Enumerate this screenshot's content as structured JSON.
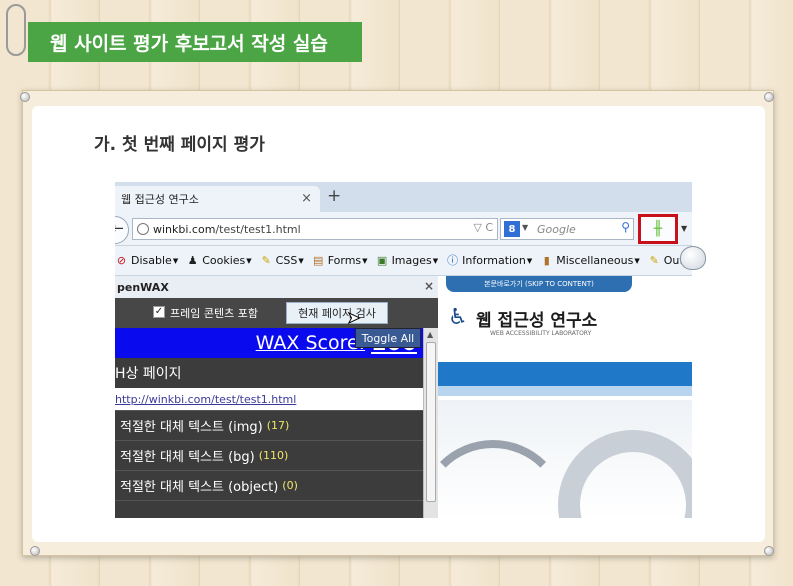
{
  "slide": {
    "header_title": "웹 사이트 평가 후보고서 작성 실습",
    "section_title": "가. 첫 번째 페이지 평가"
  },
  "browser": {
    "tab_title": "웹 접근성 연구소",
    "tab_close": "×",
    "new_tab": "+",
    "url_host": "winkbi.com",
    "url_path": "/test/test1.html",
    "url_icons": "▽ C",
    "search_placeholder": "Google",
    "search_engine_letter": "8",
    "toolbar": [
      {
        "label": "Disable",
        "icon": "⊘",
        "color": "#c8101a"
      },
      {
        "label": "Cookies",
        "icon": "♟",
        "color": "#222"
      },
      {
        "label": "CSS",
        "icon": "✎",
        "color": "#c9a300"
      },
      {
        "label": "Forms",
        "icon": "▤",
        "color": "#b0722a"
      },
      {
        "label": "Images",
        "icon": "▣",
        "color": "#3c7a2c"
      },
      {
        "label": "Information",
        "icon": "ⓘ",
        "color": "#1f5fbf"
      },
      {
        "label": "Miscellaneous",
        "icon": "▮",
        "color": "#b0722a"
      },
      {
        "label": "Outline",
        "icon": "✎",
        "color": "#c9a300"
      }
    ]
  },
  "wax": {
    "panel_title": "penWAX",
    "panel_close": "×",
    "frame_checkbox_label": "프레임 콘텐츠 포함",
    "frame_checked_mark": "✓",
    "check_button": "현재 페이지 검사",
    "toggle_all": "Toggle All",
    "score_label": "WAX Score:",
    "score_value": "100",
    "target_label": "H상 페이지",
    "target_url": "http://winkbi.com/test/test1.html",
    "items": [
      {
        "label": "적절한 대체 텍스트 (img)",
        "count": "(17)"
      },
      {
        "label": "적절한 대체 텍스트 (bg)",
        "count": "(110)"
      },
      {
        "label": "적절한 대체 텍스트 (object)",
        "count": "(0)"
      }
    ]
  },
  "site": {
    "skip_link": "본문바로가기 (SKIP TO CONTENT)",
    "logo_icon": "accessibility-icon",
    "name": "웹 접근성 연구소",
    "subtitle": "WEB ACCESSIBILITY LABORATORY"
  },
  "colors": {
    "header_green": "#4ba544",
    "score_blue": "#0a0aef",
    "highlight_red": "#c8101a",
    "site_band_blue": "#1f78c8"
  }
}
